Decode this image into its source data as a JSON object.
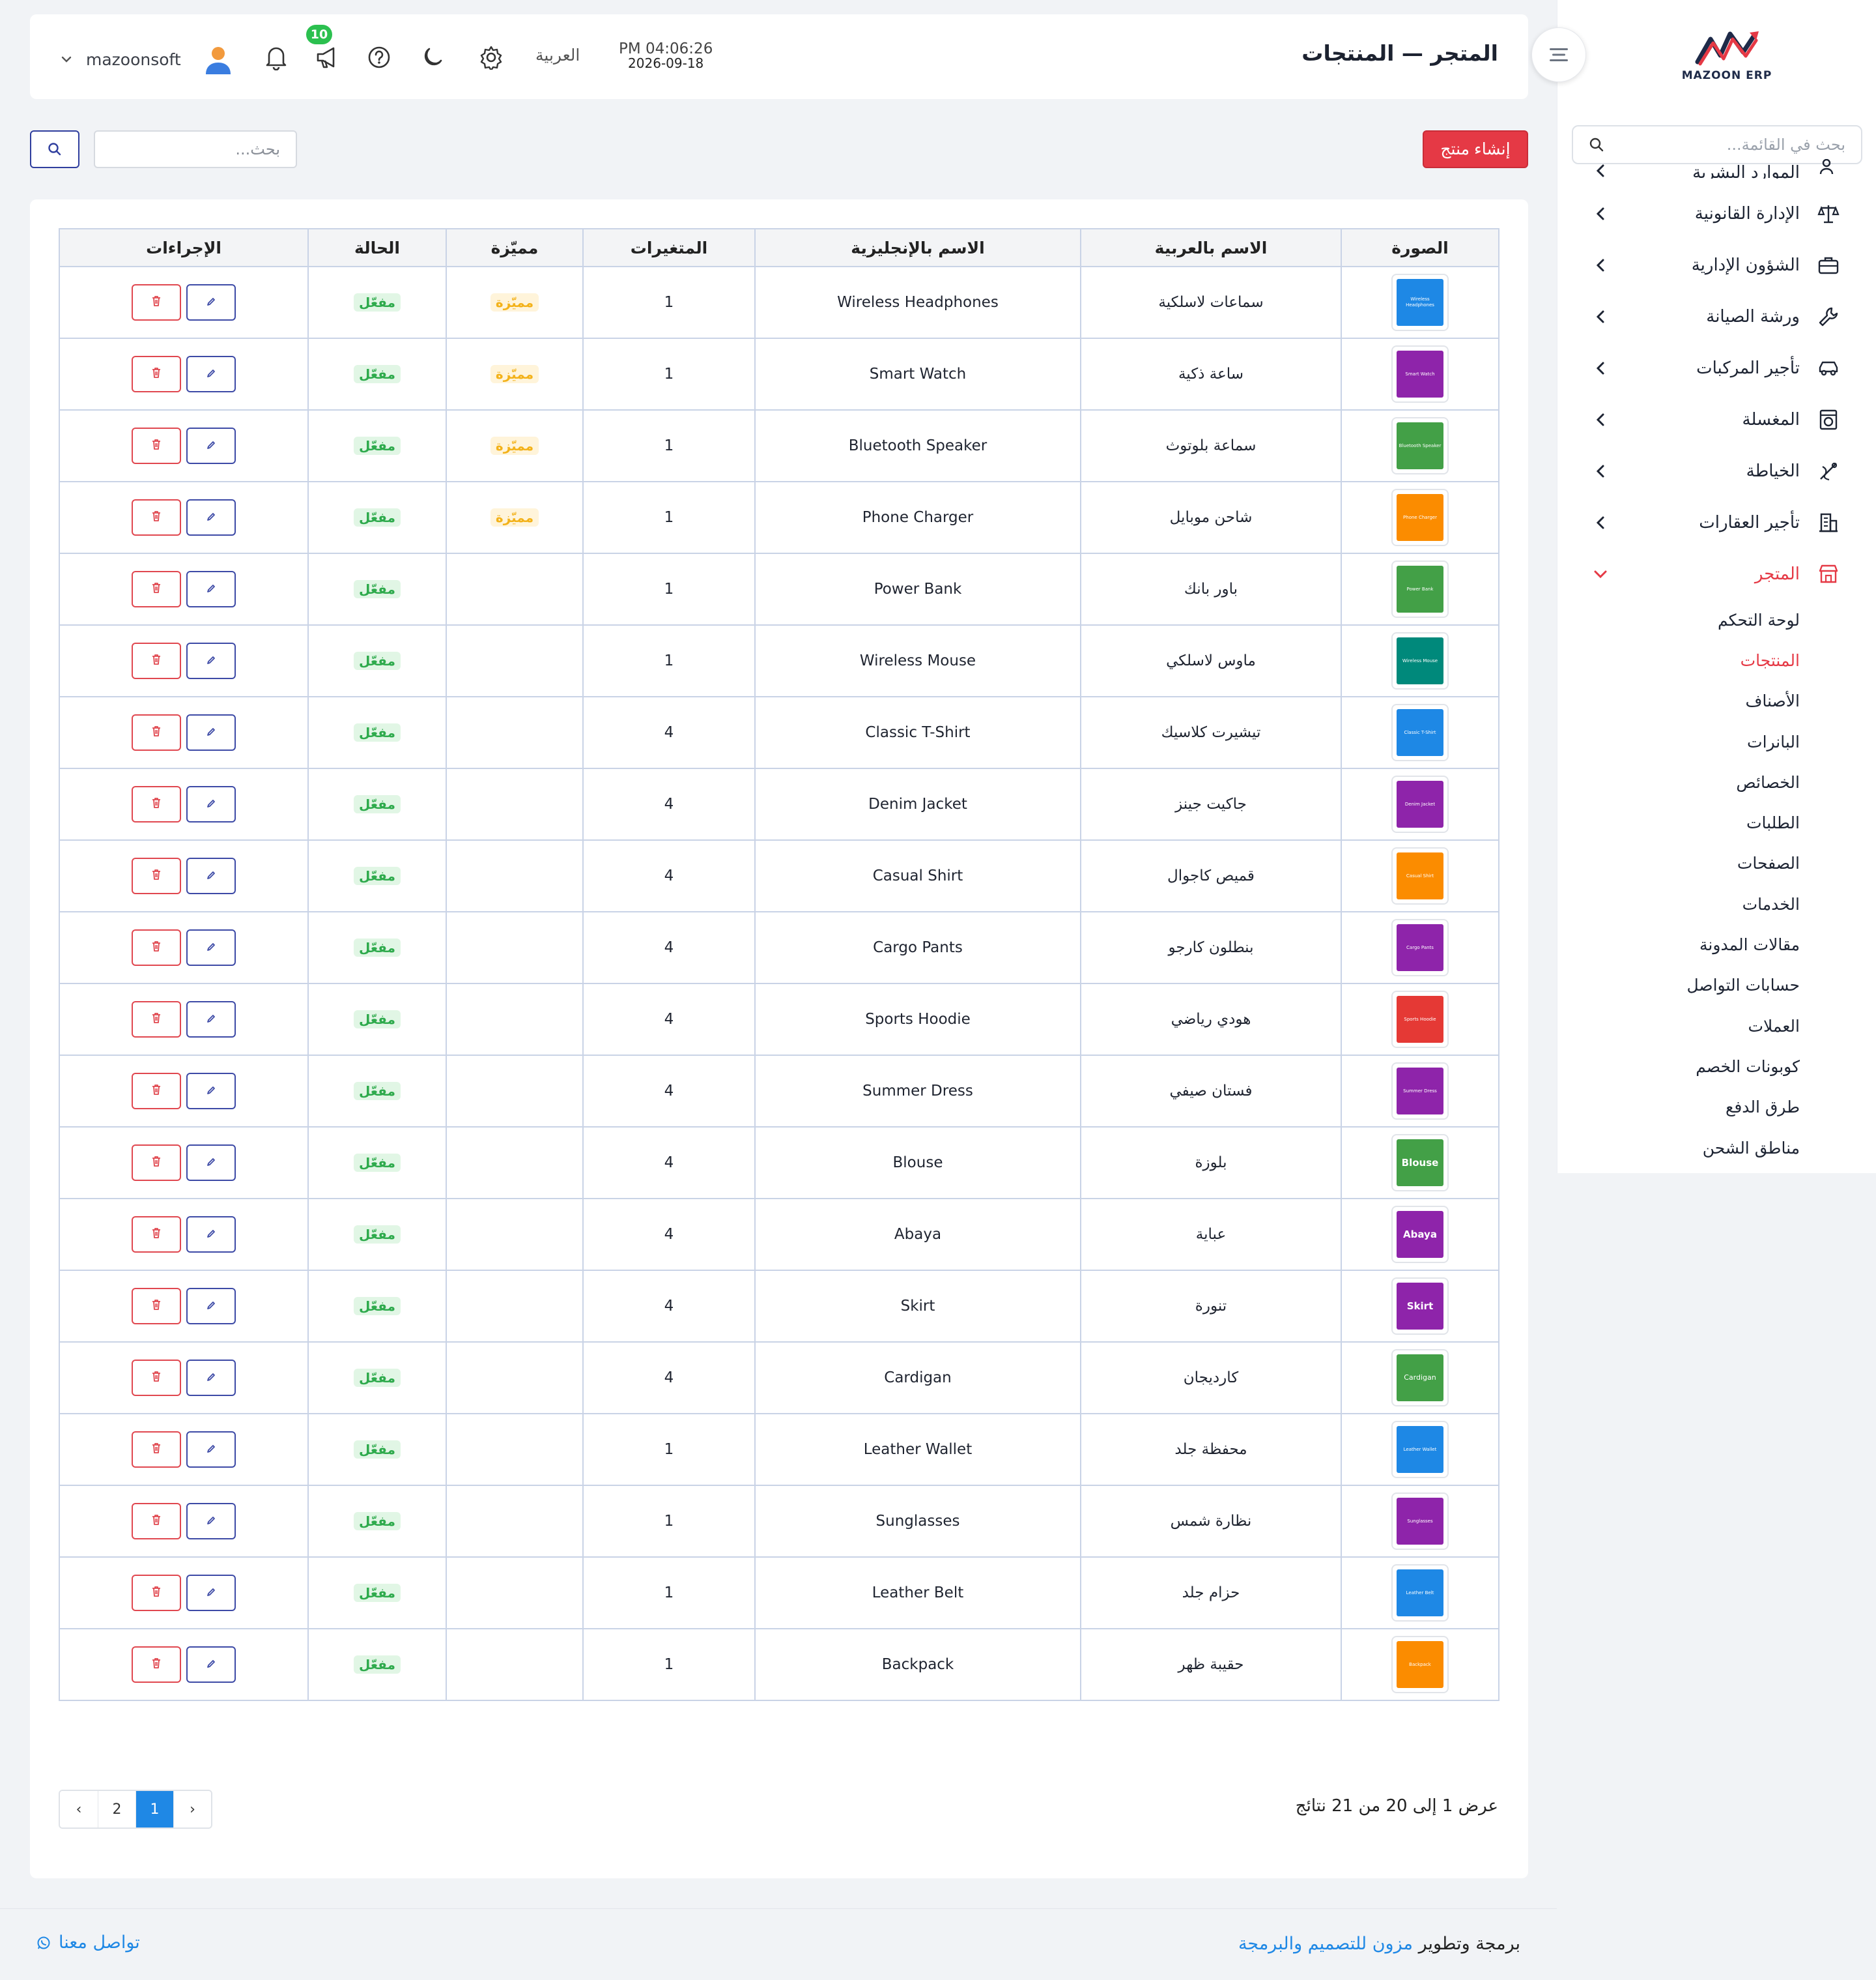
{
  "app": {
    "logo_text": "MAZOON ERP",
    "page_title": "المتجر — المنتجات",
    "time": "PM 04:06:26",
    "date": "2026-09-18",
    "language": "العربية",
    "notification_badge": "10",
    "username": "mazoonsoft",
    "accent_color": "#e53945",
    "primary_color": "#1f88e5"
  },
  "sidebar": {
    "search_placeholder": "بحث في القائمة...",
    "partial_item": "الموارد البشرية",
    "items": [
      {
        "label": "الإدارة القانونية",
        "icon": "scales-icon"
      },
      {
        "label": "الشؤون الإدارية",
        "icon": "briefcase-icon"
      },
      {
        "label": "ورشة الصيانة",
        "icon": "wrench-icon"
      },
      {
        "label": "تأجير المركبات",
        "icon": "car-icon"
      },
      {
        "label": "المغسلة",
        "icon": "washing-machine-icon"
      },
      {
        "label": "الخياطة",
        "icon": "sewing-icon"
      },
      {
        "label": "تأجير العقارات",
        "icon": "building-icon"
      },
      {
        "label": "المتجر",
        "icon": "store-icon",
        "active": true
      }
    ],
    "store_submenu": [
      {
        "label": "لوحة التحكم"
      },
      {
        "label": "المنتجات",
        "active": true
      },
      {
        "label": "الأصناف"
      },
      {
        "label": "البانرات"
      },
      {
        "label": "الخصائص"
      },
      {
        "label": "الطلبات"
      },
      {
        "label": "الصفحات"
      },
      {
        "label": "الخدمات"
      },
      {
        "label": "مقالات المدونة"
      },
      {
        "label": "حسابات التواصل"
      },
      {
        "label": "العملات"
      },
      {
        "label": "كوبونات الخصم"
      },
      {
        "label": "طرق الدفع"
      },
      {
        "label": "مناطق الشحن"
      }
    ]
  },
  "toolbar": {
    "create_label": "إنشاء منتج",
    "search_placeholder": "بحث..."
  },
  "table": {
    "headers": {
      "image": "الصورة",
      "name_ar": "الاسم بالعربية",
      "name_en": "الاسم بالإنجليزية",
      "variants": "المتغيرات",
      "featured": "مميّزة",
      "status": "الحالة",
      "actions": "الإجراءات"
    },
    "featured_label": "مميّزة",
    "status_label": "مفعّل",
    "rows": [
      {
        "thumb_label": "Wireless Headphones",
        "thumb_color": "#1e88e5",
        "name_ar": "سماعات لاسلكية",
        "name_en": "Wireless Headphones",
        "variants": "1",
        "featured": true
      },
      {
        "thumb_label": "Smart Watch",
        "thumb_color": "#8e24aa",
        "name_ar": "ساعة ذكية",
        "name_en": "Smart Watch",
        "variants": "1",
        "featured": true
      },
      {
        "thumb_label": "Bluetooth Speaker",
        "thumb_color": "#43a047",
        "name_ar": "سماعة بلوتوث",
        "name_en": "Bluetooth Speaker",
        "variants": "1",
        "featured": true
      },
      {
        "thumb_label": "Phone Charger",
        "thumb_color": "#fb8c00",
        "name_ar": "شاحن موبايل",
        "name_en": "Phone Charger",
        "variants": "1",
        "featured": true
      },
      {
        "thumb_label": "Power Bank",
        "thumb_color": "#43a047",
        "name_ar": "باور بانك",
        "name_en": "Power Bank",
        "variants": "1",
        "featured": false
      },
      {
        "thumb_label": "Wireless Mouse",
        "thumb_color": "#00897b",
        "name_ar": "ماوس لاسلكي",
        "name_en": "Wireless Mouse",
        "variants": "1",
        "featured": false
      },
      {
        "thumb_label": "Classic T-Shirt",
        "thumb_color": "#1e88e5",
        "name_ar": "تيشيرت كلاسيك",
        "name_en": "Classic T-Shirt",
        "variants": "4",
        "featured": false
      },
      {
        "thumb_label": "Denim Jacket",
        "thumb_color": "#8e24aa",
        "name_ar": "جاكيت جينز",
        "name_en": "Denim Jacket",
        "variants": "4",
        "featured": false
      },
      {
        "thumb_label": "Casual Shirt",
        "thumb_color": "#fb8c00",
        "name_ar": "قميص كاجوال",
        "name_en": "Casual Shirt",
        "variants": "4",
        "featured": false
      },
      {
        "thumb_label": "Cargo Pants",
        "thumb_color": "#8e24aa",
        "name_ar": "بنطلون كارجو",
        "name_en": "Cargo Pants",
        "variants": "4",
        "featured": false
      },
      {
        "thumb_label": "Sports Hoodie",
        "thumb_color": "#e53935",
        "name_ar": "هودي رياضي",
        "name_en": "Sports Hoodie",
        "variants": "4",
        "featured": false
      },
      {
        "thumb_label": "Summer Dress",
        "thumb_color": "#8e24aa",
        "name_ar": "فستان صيفي",
        "name_en": "Summer Dress",
        "variants": "4",
        "featured": false
      },
      {
        "thumb_label": "Blouse",
        "thumb_color": "#43a047",
        "name_ar": "بلوزة",
        "name_en": "Blouse",
        "variants": "4",
        "featured": false
      },
      {
        "thumb_label": "Abaya",
        "thumb_color": "#8e24aa",
        "name_ar": "عباية",
        "name_en": "Abaya",
        "variants": "4",
        "featured": false
      },
      {
        "thumb_label": "Skirt",
        "thumb_color": "#8e24aa",
        "name_ar": "تنورة",
        "name_en": "Skirt",
        "variants": "4",
        "featured": false
      },
      {
        "thumb_label": "Cardigan",
        "thumb_color": "#43a047",
        "name_ar": "كارديجان",
        "name_en": "Cardigan",
        "variants": "4",
        "featured": false
      },
      {
        "thumb_label": "Leather Wallet",
        "thumb_color": "#1e88e5",
        "name_ar": "محفظة جلد",
        "name_en": "Leather Wallet",
        "variants": "1",
        "featured": false
      },
      {
        "thumb_label": "Sunglasses",
        "thumb_color": "#8e24aa",
        "name_ar": "نظارة شمس",
        "name_en": "Sunglasses",
        "variants": "1",
        "featured": false
      },
      {
        "thumb_label": "Leather Belt",
        "thumb_color": "#1e88e5",
        "name_ar": "حزام جلد",
        "name_en": "Leather Belt",
        "variants": "1",
        "featured": false
      },
      {
        "thumb_label": "Backpack",
        "thumb_color": "#fb8c00",
        "name_ar": "حقيبة ظهر",
        "name_en": "Backpack",
        "variants": "1",
        "featured": false
      }
    ]
  },
  "pagination": {
    "summary": "عرض 1 إلى 20 من 21 نتائج",
    "pages": [
      "1",
      "2"
    ],
    "current": "1",
    "prev": "‹",
    "next": "›"
  },
  "footer": {
    "credit_prefix": "برمجة وتطوير",
    "credit_brand": "مزون للتصميم والبرمجة",
    "contact": "تواصل معنا"
  }
}
